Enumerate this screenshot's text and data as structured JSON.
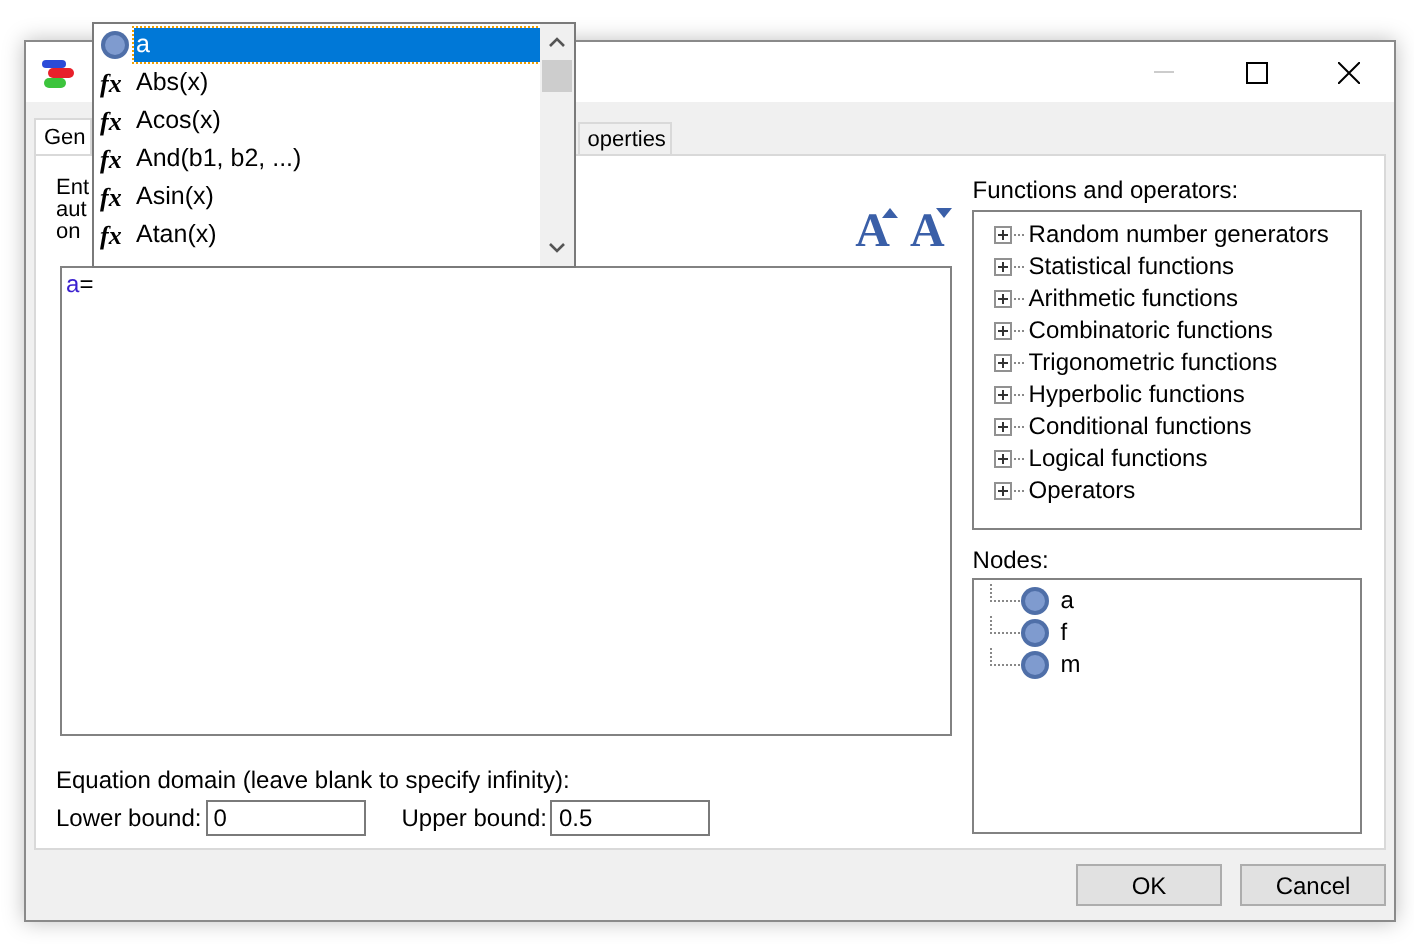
{
  "window": {
    "minimize_disabled": true
  },
  "tabs": [
    {
      "label": "Gen",
      "selected": true
    },
    {
      "label": "operties",
      "selected": false
    }
  ],
  "description_lines": [
    "Ent",
    "aut",
    "on"
  ],
  "font_buttons": [
    {
      "label": "A",
      "kind": "increase"
    },
    {
      "label": "A",
      "kind": "decrease"
    }
  ],
  "editor": {
    "variable": "a",
    "operator": "="
  },
  "domain": {
    "label": "Equation domain (leave blank to specify infinity):",
    "lower_label": "Lower bound:",
    "lower_value": "0",
    "upper_label": "Upper bound:",
    "upper_value": "0.5"
  },
  "functions_panel": {
    "label": "Functions and operators:",
    "items": [
      {
        "label": "Random number generators",
        "expanded": false
      },
      {
        "label": "Statistical functions",
        "expanded": false
      },
      {
        "label": "Arithmetic functions",
        "expanded": false
      },
      {
        "label": "Combinatoric functions",
        "expanded": false
      },
      {
        "label": "Trigonometric functions",
        "expanded": false
      },
      {
        "label": "Hyperbolic functions",
        "expanded": false
      },
      {
        "label": "Conditional functions",
        "expanded": false
      },
      {
        "label": "Logical functions",
        "expanded": false
      },
      {
        "label": "Operators",
        "expanded": false
      }
    ]
  },
  "nodes_panel": {
    "label": "Nodes:",
    "items": [
      "a",
      "f",
      "m"
    ]
  },
  "buttons": [
    "OK",
    "Cancel"
  ],
  "autocomplete": {
    "items": [
      {
        "kind": "node",
        "label": "a",
        "selected": true
      },
      {
        "kind": "function",
        "icon": "fx",
        "label": "Abs(x)",
        "selected": false
      },
      {
        "kind": "function",
        "icon": "fx",
        "label": "Acos(x)",
        "selected": false
      },
      {
        "kind": "function",
        "icon": "fx",
        "label": "And(b1, b2, ...)",
        "selected": false
      },
      {
        "kind": "function",
        "icon": "fx",
        "label": "Asin(x)",
        "selected": false
      },
      {
        "kind": "function",
        "icon": "fx",
        "label": "Atan(x)",
        "selected": false
      }
    ]
  }
}
